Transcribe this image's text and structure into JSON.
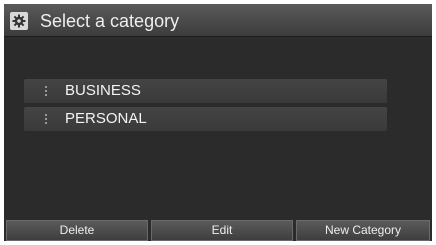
{
  "header": {
    "icon": "gear-icon",
    "title": "Select a category"
  },
  "list": {
    "items": [
      {
        "label": "BUSINESS"
      },
      {
        "label": "PERSONAL"
      }
    ]
  },
  "buttons": {
    "delete": "Delete",
    "edit": "Edit",
    "new_category": "New Category"
  }
}
